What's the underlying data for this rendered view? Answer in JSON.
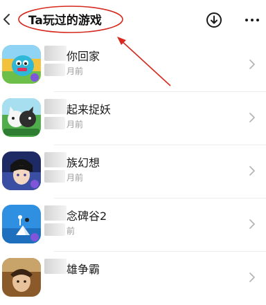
{
  "header": {
    "title": "Ta玩过的游戏",
    "back_icon": "chevron-left-icon",
    "download_icon": "download-circle-icon",
    "more_icon": "more-dots-icon",
    "annotation_color": "#d6281e"
  },
  "games": [
    {
      "name": "你回家",
      "time": "月前",
      "icon": "blue-monster-game-icon"
    },
    {
      "name": "起来捉妖",
      "time": "月前",
      "icon": "cats-game-icon"
    },
    {
      "name": "族幻想",
      "time": "月前",
      "icon": "anime-character-game-icon"
    },
    {
      "name": "念碑谷2",
      "time": "前",
      "icon": "monument-valley-icon"
    },
    {
      "name": "雄争霸",
      "time": "",
      "icon": "warrior-game-icon"
    }
  ]
}
